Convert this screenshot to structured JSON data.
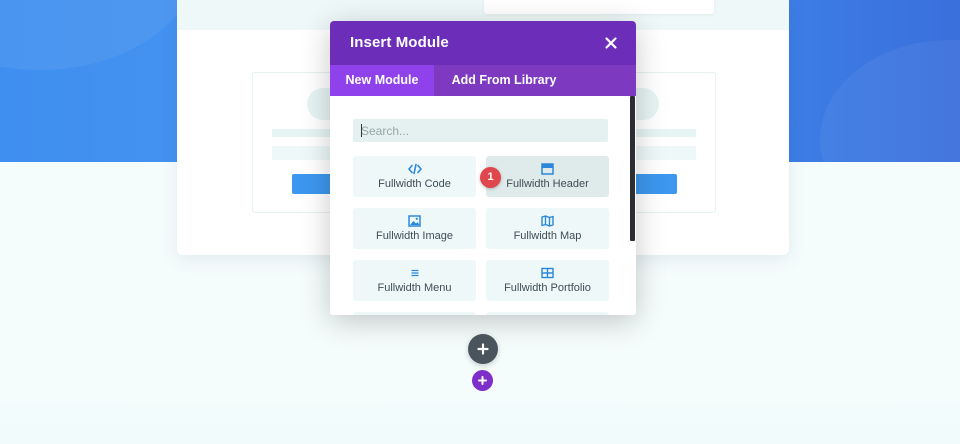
{
  "modal": {
    "title": "Insert Module",
    "close_icon": "close-icon",
    "tabs": [
      {
        "label": "New Module",
        "active": true
      },
      {
        "label": "Add From Library",
        "active": false
      }
    ],
    "search": {
      "placeholder": "Search...",
      "value": ""
    },
    "modules": [
      {
        "label": "Fullwidth Code",
        "icon": "code-icon"
      },
      {
        "label": "Fullwidth Header",
        "icon": "header-layout-icon"
      },
      {
        "label": "Fullwidth Image",
        "icon": "image-icon"
      },
      {
        "label": "Fullwidth Map",
        "icon": "map-icon"
      },
      {
        "label": "Fullwidth Menu",
        "icon": "menu-icon"
      },
      {
        "label": "Fullwidth Portfolio",
        "icon": "portfolio-grid-icon"
      }
    ]
  },
  "annotation": {
    "step_number": "1"
  },
  "colors": {
    "header": "#6c2eb9",
    "tab_bar": "#7d3ac1",
    "active_tab": "#8f42ec",
    "tile_bg": "#eef8f8",
    "icon_blue": "#2b87da",
    "badge_red": "#e0474c",
    "add_row_button": "#4a545c",
    "add_section_button": "#7e2fc9",
    "hero_blue": "#3f8ff0"
  },
  "buttons": {
    "add_row_icon": "plus-icon",
    "add_section_icon": "plus-icon"
  }
}
